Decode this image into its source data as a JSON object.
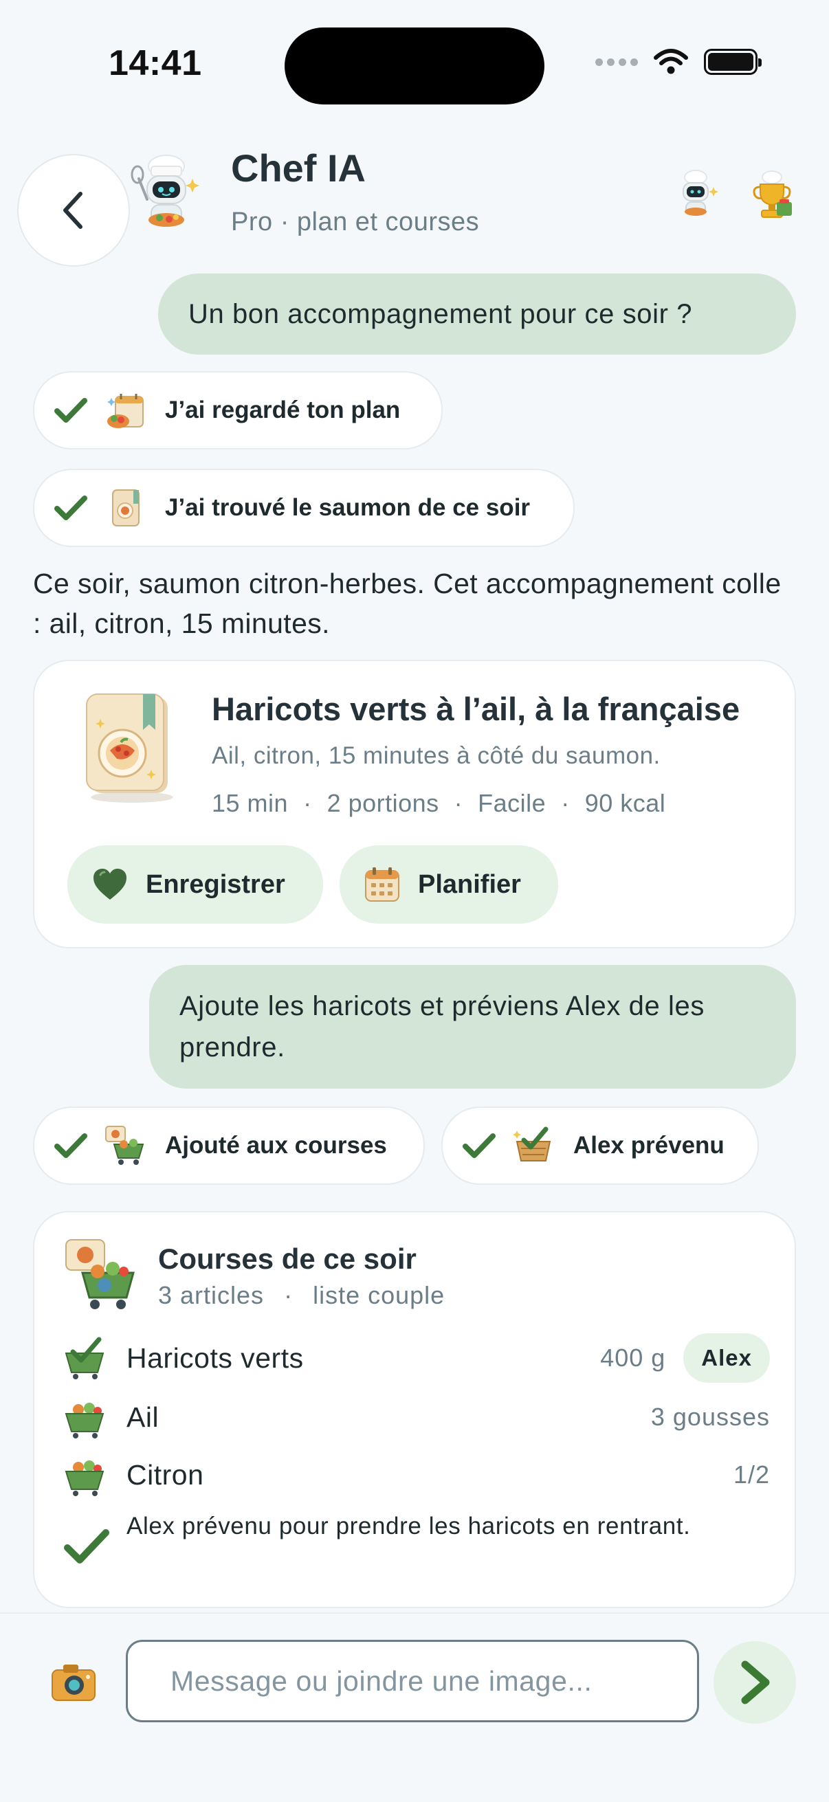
{
  "status_bar": {
    "time": "14:41"
  },
  "header": {
    "title": "Chef IA",
    "subtitle": "Pro · plan et courses",
    "avatar_icon": "robot-chef-icon",
    "right_icons": [
      "robot-chef-icon",
      "trophy-icon"
    ]
  },
  "messages": {
    "user1": "Un bon accompagnement pour ce soir ?",
    "tool_pills_1": [
      {
        "icon": "calendar-plan-icon",
        "label": "J’ai regardé ton plan"
      },
      {
        "icon": "recipe-book-icon",
        "label": "J’ai trouvé le saumon de ce soir"
      }
    ],
    "ai_text": "Ce soir, saumon citron-herbes. Cet accompagnement colle : ail, citron, 15 minutes.",
    "recipe_card": {
      "image_icon": "recipe-book-icon",
      "title": "Haricots verts à l’ail, à la française",
      "description": "Ail, citron, 15 minutes à côté du saumon.",
      "meta": [
        "15 min",
        "2 portions",
        "Facile",
        "90 kcal"
      ],
      "meta_separator": "·",
      "save_label": "Enregistrer",
      "plan_label": "Planifier"
    },
    "user2": "Ajoute les haricots et préviens Alex de les prendre.",
    "tool_pills_2": [
      {
        "icon": "cart-add-icon",
        "label": "Ajouté aux courses"
      },
      {
        "icon": "basket-check-icon",
        "label": "Alex prévenu"
      }
    ],
    "shopping_card": {
      "title": "Courses de ce soir",
      "subtitle_count": "3 articles",
      "subtitle_list": "liste couple",
      "items": [
        {
          "name": "Haricots verts",
          "qty": "400 g",
          "assignee": "Alex"
        },
        {
          "name": "Ail",
          "qty": "3 gousses"
        },
        {
          "name": "Citron",
          "qty": "1/2"
        }
      ],
      "notify_text": "Alex prévenu pour prendre les haricots en rentrant."
    }
  },
  "composer": {
    "placeholder": "Message ou joindre une image..."
  },
  "colors": {
    "background": "#f5f8fa",
    "user_bubble": "#d3e5d6",
    "accent_green": "#3d7a3a",
    "muted_text": "#6b7e87",
    "chip_green": "#e5f2e6"
  }
}
